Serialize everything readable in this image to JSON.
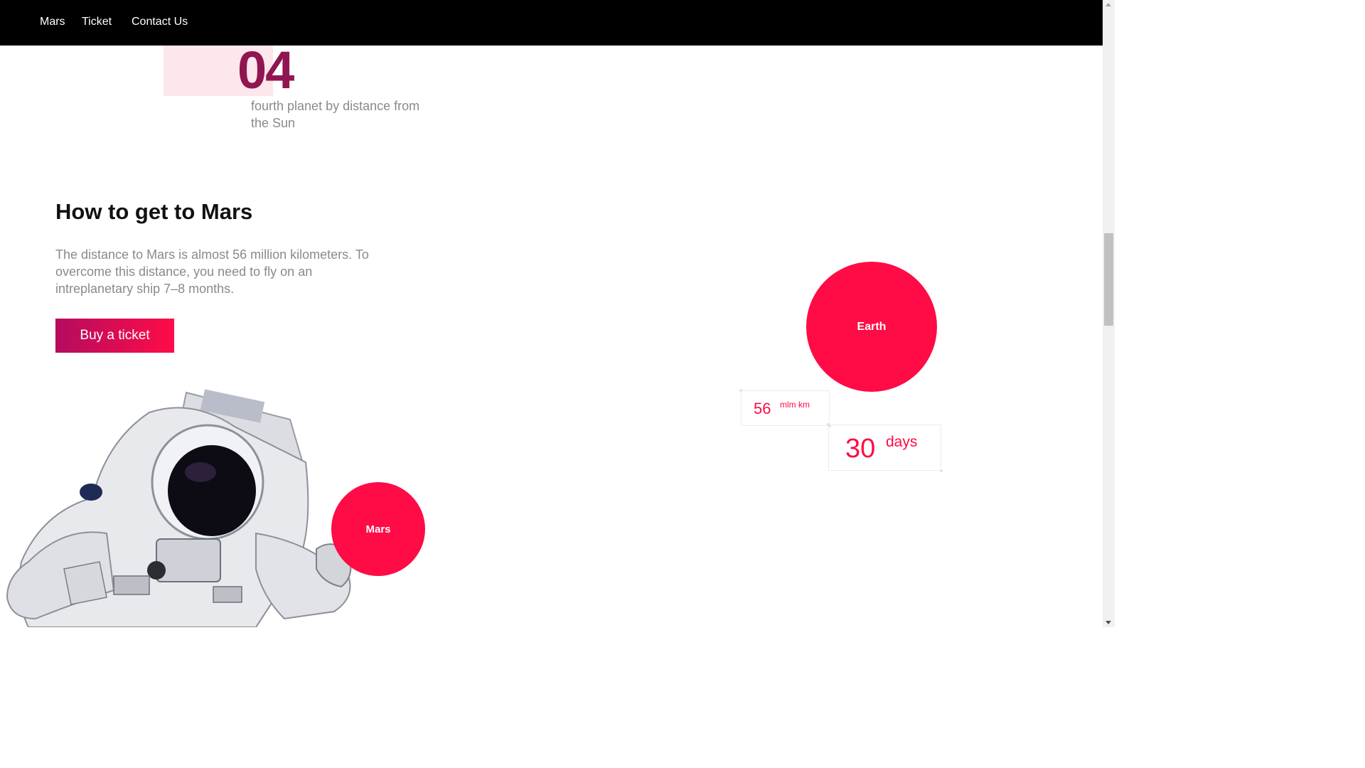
{
  "nav": {
    "items": [
      "Mars",
      "Ticket",
      "Contact Us"
    ]
  },
  "fact": {
    "number": "04",
    "caption": "fourth planet by distance from the Sun"
  },
  "section": {
    "title": "How to get to Mars",
    "text": "The distance to Mars is almost 56 million kilometers. To overcome this distance, you need to fly on an intreplanetary ship 7–8 months.",
    "button": "Buy a ticket"
  },
  "planets": {
    "mars": "Mars",
    "earth": "Earth"
  },
  "stats": {
    "distance": {
      "value": "56",
      "unit": "mlm km"
    },
    "time": {
      "value": "30",
      "unit": "days"
    }
  },
  "colors": {
    "accent": "#ff0b45",
    "accent_dark": "#8f1650",
    "button_start": "#b40c5e",
    "fact_bg": "#fde6ec",
    "topbar": "#000000"
  },
  "icons": {
    "illustration": "astronaut-illustration"
  }
}
